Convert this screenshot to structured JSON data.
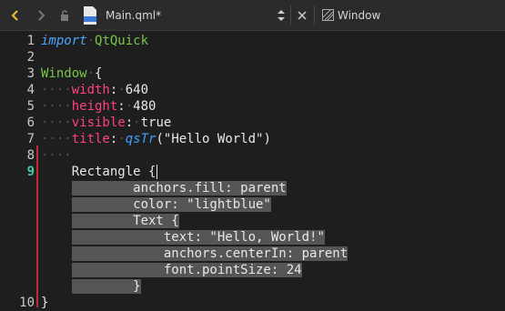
{
  "toolbar": {
    "file_name": "Main.qml*",
    "file_icon_label": "qml",
    "symbol_label": "Window",
    "icons": [
      "back-icon",
      "forward-icon",
      "lock-icon",
      "file-icon",
      "updown-icon",
      "close-icon",
      "hash-icon"
    ]
  },
  "editor": {
    "lines": [
      {
        "n": "1",
        "segments": [
          [
            "kw",
            "import"
          ],
          [
            "ws",
            "·"
          ],
          [
            "type",
            "QtQuick"
          ]
        ]
      },
      {
        "n": "2",
        "segments": []
      },
      {
        "n": "3",
        "segments": [
          [
            "type",
            "Window"
          ],
          [
            "ws",
            "·"
          ],
          [
            "plain",
            "{"
          ]
        ]
      },
      {
        "n": "4",
        "segments": [
          [
            "ws",
            "····"
          ],
          [
            "prop",
            "width"
          ],
          [
            "plain",
            ":"
          ],
          [
            "ws",
            "·"
          ],
          [
            "num",
            "640"
          ]
        ]
      },
      {
        "n": "5",
        "segments": [
          [
            "ws",
            "····"
          ],
          [
            "prop",
            "height"
          ],
          [
            "plain",
            ":"
          ],
          [
            "ws",
            "·"
          ],
          [
            "num",
            "480"
          ]
        ]
      },
      {
        "n": "6",
        "segments": [
          [
            "ws",
            "····"
          ],
          [
            "prop",
            "visible"
          ],
          [
            "plain",
            ":"
          ],
          [
            "ws",
            "·"
          ],
          [
            "num",
            "true"
          ]
        ]
      },
      {
        "n": "7",
        "segments": [
          [
            "ws",
            "····"
          ],
          [
            "prop",
            "title"
          ],
          [
            "plain",
            ":"
          ],
          [
            "ws",
            "·"
          ],
          [
            "fn",
            "qsTr"
          ],
          [
            "str",
            "(\"Hello World\")"
          ]
        ]
      },
      {
        "n": "8",
        "segments": [
          [
            "ws",
            "····"
          ]
        ]
      },
      {
        "n": "9",
        "current": true,
        "segments": [
          [
            "plain",
            "    Rectangle {"
          ]
        ]
      },
      {
        "n": "",
        "segments": [
          [
            "plain",
            "    "
          ],
          [
            "sel",
            "        anchors.fill: parent"
          ]
        ]
      },
      {
        "n": "",
        "segments": [
          [
            "plain",
            "    "
          ],
          [
            "sel",
            "        color: \"lightblue\""
          ]
        ]
      },
      {
        "n": "",
        "segments": [
          [
            "plain",
            "    "
          ],
          [
            "sel",
            "        Text {"
          ]
        ]
      },
      {
        "n": "",
        "segments": [
          [
            "plain",
            "    "
          ],
          [
            "sel",
            "            text: \"Hello, World!\""
          ]
        ]
      },
      {
        "n": "",
        "segments": [
          [
            "plain",
            "    "
          ],
          [
            "sel",
            "            anchors.centerIn: parent"
          ]
        ]
      },
      {
        "n": "",
        "segments": [
          [
            "plain",
            "    "
          ],
          [
            "sel",
            "            font.pointSize: 24"
          ]
        ]
      },
      {
        "n": "",
        "segments": [
          [
            "plain",
            "    "
          ],
          [
            "sel",
            "        }"
          ]
        ]
      },
      {
        "n": "10",
        "segments": [
          [
            "plain",
            "}"
          ]
        ]
      }
    ]
  }
}
